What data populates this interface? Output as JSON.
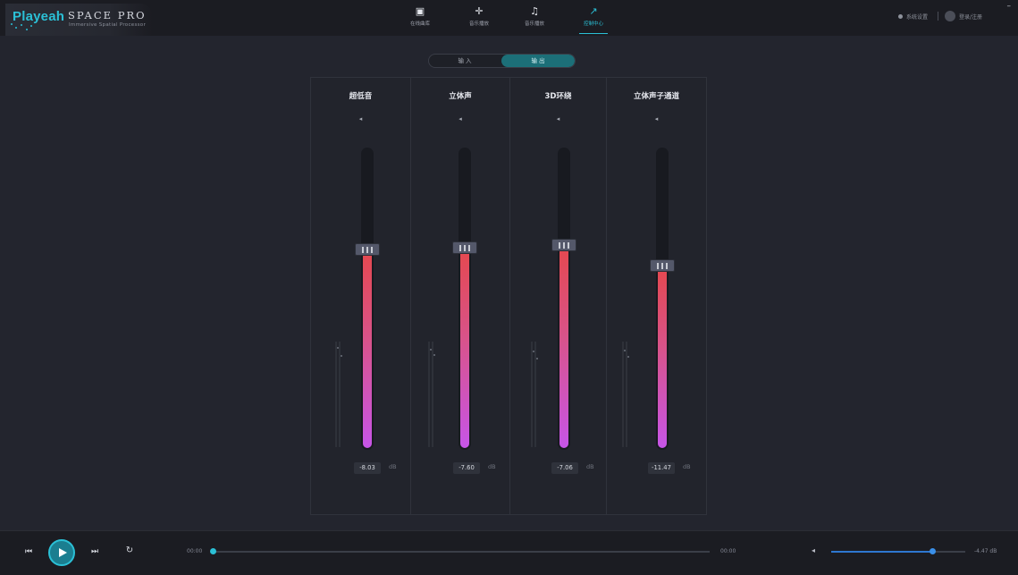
{
  "brand": {
    "logo": "Playeah",
    "name": "SPACE PRO",
    "subtitle": "Immersive Spatial Processor"
  },
  "nav": [
    {
      "label": "在线曲库",
      "icon": "music-library-icon",
      "active": false
    },
    {
      "label": "音乐播放",
      "icon": "music-play-icon",
      "active": false
    },
    {
      "label": "音乐播放",
      "icon": "music-note-icon",
      "active": false
    },
    {
      "label": "控制中心",
      "icon": "control-center-icon",
      "active": true
    }
  ],
  "top_right": {
    "settings_label": "系统设置",
    "user_label": "登录/注册",
    "minimize": "–"
  },
  "tabs": {
    "input_label": "输 入",
    "output_label": "输 出",
    "active": "output"
  },
  "channels": [
    {
      "title": "超低音",
      "value": "-8.03",
      "unit": "dB",
      "level": 0.66
    },
    {
      "title": "立体声",
      "value": "-7.60",
      "unit": "dB",
      "level": 0.665
    },
    {
      "title": "3D环绕",
      "value": "-7.06",
      "unit": "dB",
      "level": 0.675
    },
    {
      "title": "立体声子通道",
      "value": "-11.47",
      "unit": "dB",
      "level": 0.605
    }
  ],
  "player": {
    "time_current": "00:00",
    "time_total": "00:00",
    "progress": 0,
    "volume_level": 0.75,
    "volume_value": "-4.47 dB"
  },
  "colors": {
    "accent": "#2bc0d6",
    "fill_top": "#e5484f",
    "fill_bottom": "#c755e8",
    "volume": "#3a8fe8"
  }
}
